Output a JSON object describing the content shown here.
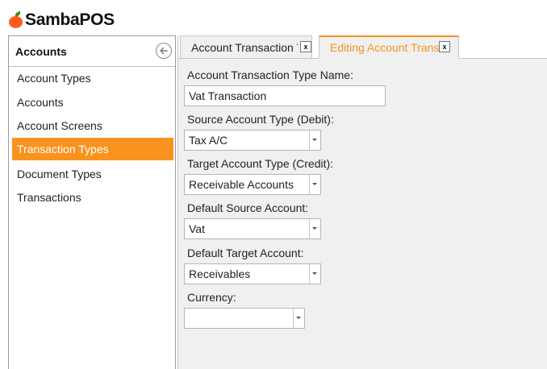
{
  "app": {
    "logo_text": "SambaPOS"
  },
  "sidebar": {
    "title": "Accounts",
    "back_icon": "circle-arrow-left-icon",
    "items": [
      {
        "label": "Account Types",
        "active": false
      },
      {
        "label": "Accounts",
        "active": false
      },
      {
        "label": "Account Screens",
        "active": false
      },
      {
        "label": "Transaction Types",
        "active": true
      },
      {
        "label": "Document Types",
        "active": false
      },
      {
        "label": "Transactions",
        "active": false
      }
    ]
  },
  "tabs": [
    {
      "label": "Account Transaction Types",
      "close": "x",
      "active": false
    },
    {
      "label": "Editing Account Transaction Type",
      "close": "x",
      "active": true
    }
  ],
  "form": {
    "name_label": "Account Transaction Type Name:",
    "name_value": "Vat Transaction",
    "source_type_label": "Source Account Type (Debit):",
    "source_type_value": "Tax A/C",
    "target_type_label": "Target Account Type (Credit):",
    "target_type_value": "Receivable Accounts",
    "default_source_label": "Default Source Account:",
    "default_source_value": "Vat",
    "default_target_label": "Default Target Account:",
    "default_target_value": "Receivables",
    "currency_label": "Currency:",
    "currency_value": ""
  },
  "colors": {
    "accent": "#f7931e",
    "logo_fruit": "#ff5a1e",
    "logo_leaf": "#4a8a1a"
  }
}
